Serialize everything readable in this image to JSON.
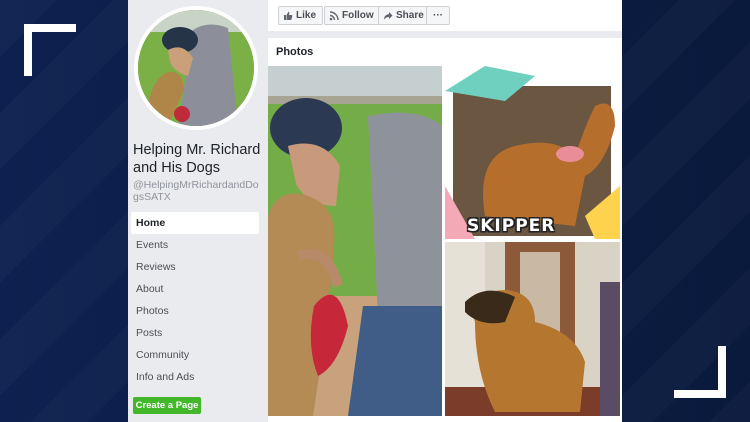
{
  "page": {
    "name": "Helping Mr. Richard and His Dogs",
    "handle": "@HelpingMrRichardandDogsSATX"
  },
  "nav": {
    "items": [
      {
        "label": "Home",
        "active": true
      },
      {
        "label": "Events"
      },
      {
        "label": "Reviews"
      },
      {
        "label": "About"
      },
      {
        "label": "Photos"
      },
      {
        "label": "Posts"
      },
      {
        "label": "Community"
      },
      {
        "label": "Info and Ads"
      }
    ],
    "create_page": "Create a Page"
  },
  "actions": {
    "like": "Like",
    "follow": "Follow",
    "share": "Share",
    "more": "···"
  },
  "photos": {
    "title": "Photos",
    "caption_skipper": "SKIPPER"
  },
  "colors": {
    "background": "#0b1b3f",
    "corner": "#ffffff",
    "create_button": "#42b72a"
  }
}
